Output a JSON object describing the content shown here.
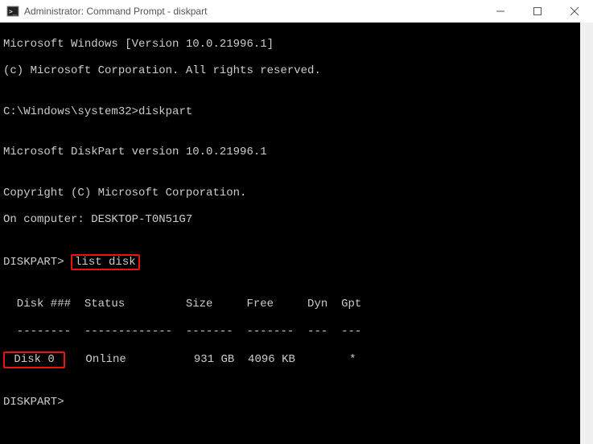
{
  "titlebar": {
    "title": "Administrator: Command Prompt - diskpart"
  },
  "terminal": {
    "line1": "Microsoft Windows [Version 10.0.21996.1]",
    "line2": "(c) Microsoft Corporation. All rights reserved.",
    "prompt1_path": "C:\\Windows\\system32>",
    "prompt1_cmd": "diskpart",
    "diskpart_version": "Microsoft DiskPart version 10.0.21996.1",
    "copyright": "Copyright (C) Microsoft Corporation.",
    "computer": "On computer: DESKTOP-T0N51G7",
    "prompt2_label": "DISKPART> ",
    "prompt2_cmd": "list disk",
    "table_header": "  Disk ###  Status         Size     Free     Dyn  Gpt",
    "table_divider": "  --------  -------------  -------  -------  ---  ---",
    "row0_disk": " Disk 0 ",
    "row0_rest": "   Online          931 GB  4096 KB        *",
    "prompt3_label": "DISKPART>"
  }
}
